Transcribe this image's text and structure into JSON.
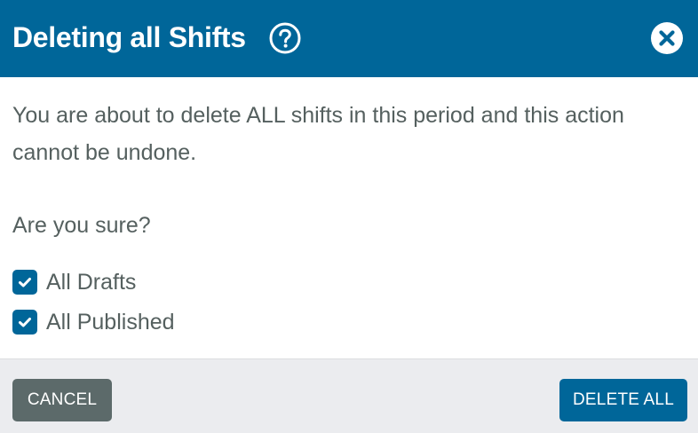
{
  "dialog": {
    "title": "Deleting all Shifts",
    "help_icon": "help-circle-icon",
    "close_icon": "close-circle-icon",
    "message": "You are about to delete ALL shifts in this period and this action cannot be undone.",
    "question": "Are you sure?",
    "options": [
      {
        "label": "All Drafts",
        "checked": true
      },
      {
        "label": "All Published",
        "checked": true
      }
    ],
    "cancel_label": "CANCEL",
    "delete_label": "DELETE ALL"
  },
  "colors": {
    "primary": "#006699",
    "text": "#55605f",
    "cancel_button": "#5c6a6a",
    "footer_bg": "#ebecef"
  }
}
